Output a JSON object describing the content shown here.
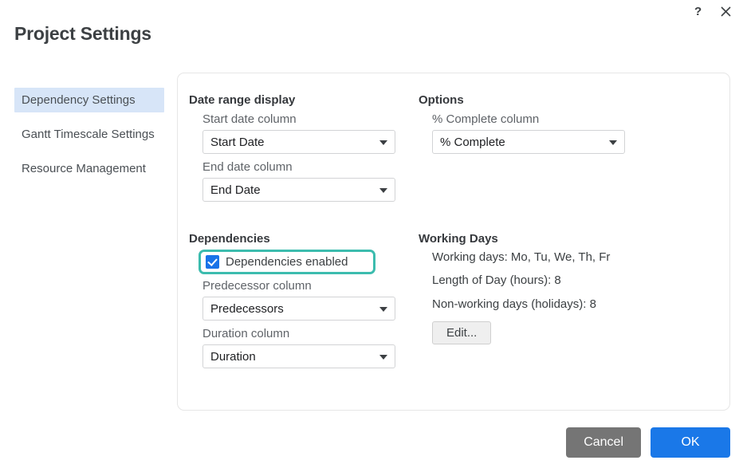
{
  "window": {
    "help_icon": "question-mark-icon",
    "close_icon": "close-x-icon"
  },
  "header": {
    "title": "Project Settings"
  },
  "sidebar": {
    "items": [
      {
        "label": "Dependency Settings",
        "active": true
      },
      {
        "label": "Gantt Timescale Settings",
        "active": false
      },
      {
        "label": "Resource Management",
        "active": false
      }
    ]
  },
  "main": {
    "date_range": {
      "title": "Date range display",
      "start_label": "Start date column",
      "start_value": "Start Date",
      "end_label": "End date column",
      "end_value": "End Date"
    },
    "options": {
      "title": "Options",
      "percent_label": "% Complete column",
      "percent_value": "% Complete"
    },
    "dependencies": {
      "title": "Dependencies",
      "enabled_label": "Dependencies enabled",
      "enabled_checked": true,
      "predecessor_label": "Predecessor column",
      "predecessor_value": "Predecessors",
      "duration_label": "Duration column",
      "duration_value": "Duration"
    },
    "working_days": {
      "title": "Working Days",
      "working_days_line": "Working days: Mo, Tu, We, Th, Fr",
      "length_of_day_line": "Length of Day (hours): 8",
      "non_working_line": "Non-working days (holidays): 8",
      "edit_label": "Edit..."
    }
  },
  "footer": {
    "cancel_label": "Cancel",
    "ok_label": "OK"
  },
  "colors": {
    "accent_blue": "#1a73e8",
    "ok_button": "#1a78e8",
    "cancel_button": "#757575",
    "highlight_ring": "#3cbcae",
    "sidebar_active": "#d7e5f8"
  }
}
